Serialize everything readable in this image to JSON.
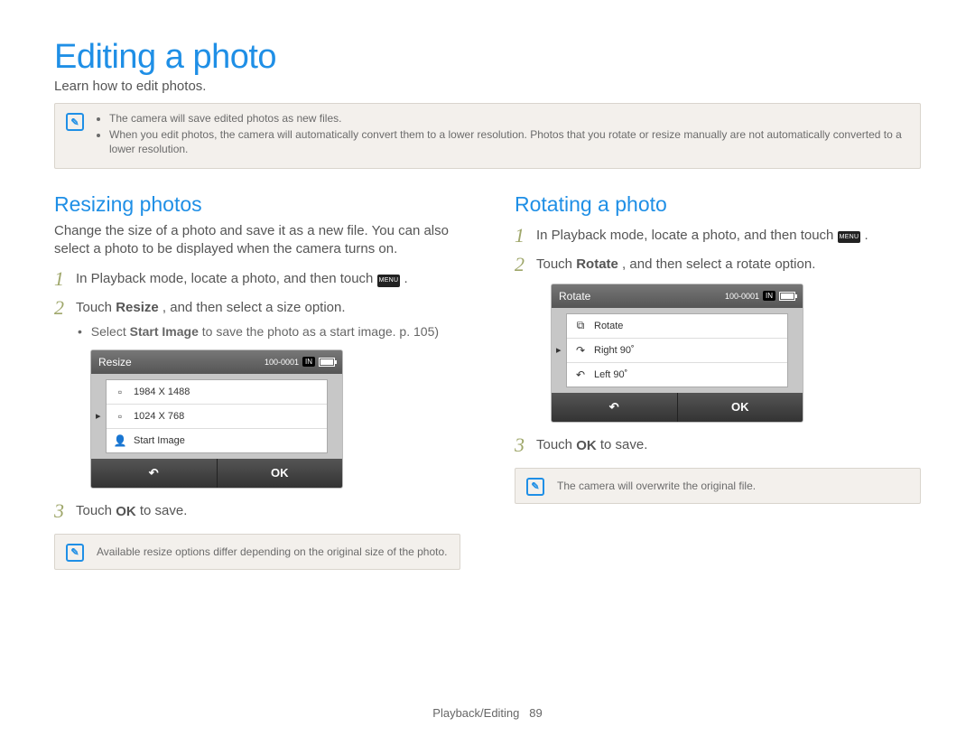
{
  "footer": {
    "section": "Playback/Editing",
    "page": "89"
  },
  "title": "Editing a photo",
  "subtitle": "Learn how to edit photos.",
  "top_note": {
    "bullets": [
      "The camera will save edited photos as new files.",
      "When you edit photos, the camera will automatically convert them to a lower resolution. Photos that you rotate or resize manually are not automatically converted to a lower resolution."
    ]
  },
  "menu_label": "MENU",
  "ok_label": "OK",
  "left": {
    "heading": "Resizing photos",
    "intro": "Change the size of a photo and save it as a new file. You can also select a photo to be displayed when the camera turns on.",
    "step1_pre": "In Playback mode, locate a photo, and then touch ",
    "step1_post": ".",
    "step2_pre": "Touch ",
    "step2_bold": "Resize",
    "step2_post": ", and then select a size option.",
    "step2_sub_pre": "Select ",
    "step2_sub_bold": "Start Image",
    "step2_sub_post": " to save the photo as a start image. p. 105)",
    "step3_pre": "Touch ",
    "step3_post": " to save.",
    "note": "Available resize options differ depending on the original size of the photo.",
    "camera": {
      "title": "Resize",
      "file_no": "100-0001",
      "storage": "IN",
      "options": [
        {
          "label": "1984 X 1488",
          "icon": "▫",
          "selected": false
        },
        {
          "label": "1024 X 768",
          "icon": "▫",
          "selected": true
        },
        {
          "label": "Start Image",
          "icon": "👤",
          "selected": false
        }
      ],
      "back": "↶",
      "ok": "OK"
    }
  },
  "right": {
    "heading": "Rotating a photo",
    "step1_pre": "In Playback mode, locate a photo, and then touch ",
    "step1_post": ".",
    "step2_pre": "Touch ",
    "step2_bold": "Rotate",
    "step2_post": ", and then select a rotate option.",
    "step3_pre": "Touch ",
    "step3_post": " to save.",
    "note": "The camera will overwrite the original file.",
    "camera": {
      "title": "Rotate",
      "file_no": "100-0001",
      "storage": "IN",
      "options": [
        {
          "label": "Rotate",
          "icon": "⧉",
          "selected": false
        },
        {
          "label": "Right 90˚",
          "icon": "↷",
          "selected": true
        },
        {
          "label": "Left 90˚",
          "icon": "↶",
          "selected": false
        }
      ],
      "back": "↶",
      "ok": "OK"
    }
  }
}
